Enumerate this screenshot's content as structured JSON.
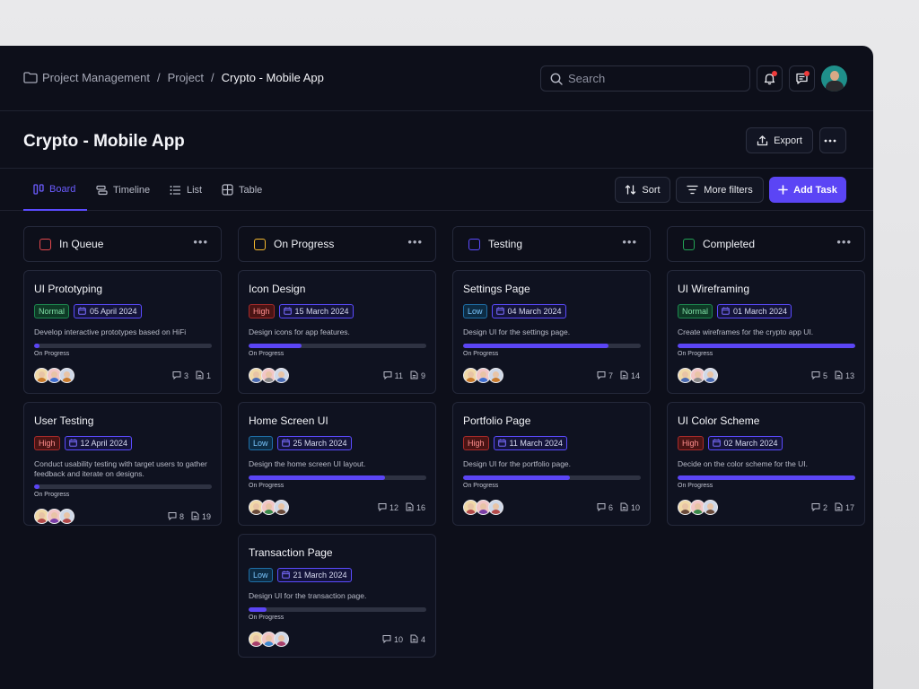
{
  "header": {
    "breadcrumb": [
      "Project Management",
      "Project",
      "Crypto - Mobile App"
    ],
    "search_placeholder": "Search"
  },
  "page": {
    "title": "Crypto - Mobile App",
    "export_label": "Export"
  },
  "views": {
    "tabs": [
      {
        "label": "Board",
        "icon": "board-icon",
        "active": true
      },
      {
        "label": "Timeline",
        "icon": "timeline-icon"
      },
      {
        "label": "List",
        "icon": "list-icon"
      },
      {
        "label": "Table",
        "icon": "table-icon"
      }
    ],
    "sort_label": "Sort",
    "filters_label": "More filters",
    "add_task_label": "Add Task"
  },
  "columns": [
    {
      "name": "In Queue",
      "color": "#e5484d",
      "cards": [
        {
          "title": "UI Prototyping",
          "priority": "Normal",
          "date": "05 April 2024",
          "desc": "Develop interactive prototypes based on HiFi",
          "progress": 3,
          "status": "On Progress",
          "comments": "3",
          "files": "1"
        },
        {
          "title": "User Testing",
          "priority": "High",
          "date": "12 April 2024",
          "desc": "Conduct usability testing with target users to gather feedback and iterate on designs.",
          "progress": 3,
          "status": "On Progress",
          "comments": "8",
          "files": "19"
        }
      ]
    },
    {
      "name": "On Progress",
      "color": "#f5b82e",
      "cards": [
        {
          "title": "Icon Design",
          "priority": "High",
          "date": "15 March 2024",
          "desc": "Design icons for app features.",
          "progress": 30,
          "status": "On Progress",
          "comments": "11",
          "files": "9"
        },
        {
          "title": "Home Screen UI",
          "priority": "Low",
          "date": "25 March 2024",
          "desc": "Design the home screen UI layout.",
          "progress": 77,
          "status": "On Progress",
          "comments": "12",
          "files": "16"
        },
        {
          "title": "Transaction Page",
          "priority": "Low",
          "date": "21 March 2024",
          "desc": "Design UI for the transaction page.",
          "progress": 10,
          "status": "On Progress",
          "comments": "10",
          "files": "4"
        }
      ]
    },
    {
      "name": "Testing",
      "color": "#5b4bff",
      "cards": [
        {
          "title": "Settings Page",
          "priority": "Low",
          "date": "04 March 2024",
          "desc": "Design UI for the settings page.",
          "progress": 82,
          "status": "On Progress",
          "comments": "7",
          "files": "14"
        },
        {
          "title": "Portfolio Page",
          "priority": "High",
          "date": "11 March 2024",
          "desc": "Design UI for the portfolio page.",
          "progress": 60,
          "status": "On Progress",
          "comments": "6",
          "files": "10"
        }
      ]
    },
    {
      "name": "Completed",
      "color": "#22a355",
      "cards": [
        {
          "title": "UI Wireframing",
          "priority": "Normal",
          "date": "01 March 2024",
          "desc": "Create wireframes for the crypto app UI.",
          "progress": 100,
          "status": "On Progress",
          "comments": "5",
          "files": "13"
        },
        {
          "title": "UI Color Scheme",
          "priority": "High",
          "date": "02 March 2024",
          "desc": "Decide on the color scheme for the UI.",
          "progress": 100,
          "status": "On Progress",
          "comments": "2",
          "files": "17"
        }
      ]
    }
  ]
}
